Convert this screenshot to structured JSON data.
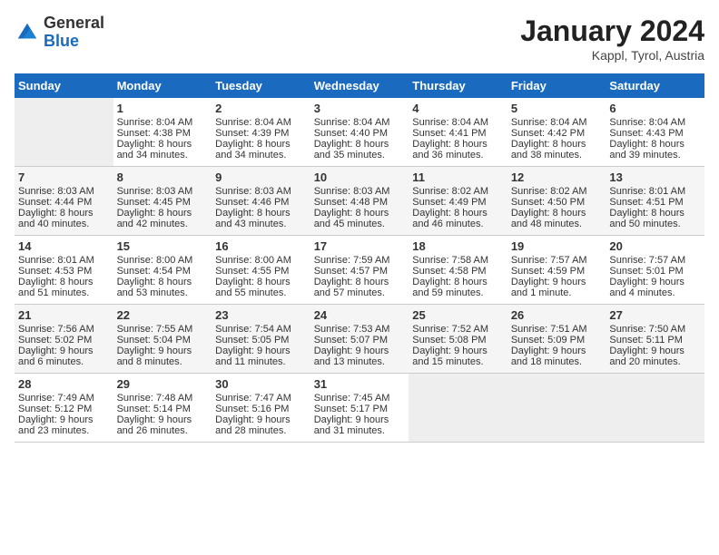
{
  "header": {
    "logo_general": "General",
    "logo_blue": "Blue",
    "month_title": "January 2024",
    "location": "Kappl, Tyrol, Austria"
  },
  "days_of_week": [
    "Sunday",
    "Monday",
    "Tuesday",
    "Wednesday",
    "Thursday",
    "Friday",
    "Saturday"
  ],
  "weeks": [
    {
      "cells": [
        {
          "day": "",
          "content": ""
        },
        {
          "day": "1",
          "content": "Sunrise: 8:04 AM\nSunset: 4:38 PM\nDaylight: 8 hours\nand 34 minutes."
        },
        {
          "day": "2",
          "content": "Sunrise: 8:04 AM\nSunset: 4:39 PM\nDaylight: 8 hours\nand 34 minutes."
        },
        {
          "day": "3",
          "content": "Sunrise: 8:04 AM\nSunset: 4:40 PM\nDaylight: 8 hours\nand 35 minutes."
        },
        {
          "day": "4",
          "content": "Sunrise: 8:04 AM\nSunset: 4:41 PM\nDaylight: 8 hours\nand 36 minutes."
        },
        {
          "day": "5",
          "content": "Sunrise: 8:04 AM\nSunset: 4:42 PM\nDaylight: 8 hours\nand 38 minutes."
        },
        {
          "day": "6",
          "content": "Sunrise: 8:04 AM\nSunset: 4:43 PM\nDaylight: 8 hours\nand 39 minutes."
        }
      ]
    },
    {
      "cells": [
        {
          "day": "7",
          "content": "Sunrise: 8:03 AM\nSunset: 4:44 PM\nDaylight: 8 hours\nand 40 minutes."
        },
        {
          "day": "8",
          "content": "Sunrise: 8:03 AM\nSunset: 4:45 PM\nDaylight: 8 hours\nand 42 minutes."
        },
        {
          "day": "9",
          "content": "Sunrise: 8:03 AM\nSunset: 4:46 PM\nDaylight: 8 hours\nand 43 minutes."
        },
        {
          "day": "10",
          "content": "Sunrise: 8:03 AM\nSunset: 4:48 PM\nDaylight: 8 hours\nand 45 minutes."
        },
        {
          "day": "11",
          "content": "Sunrise: 8:02 AM\nSunset: 4:49 PM\nDaylight: 8 hours\nand 46 minutes."
        },
        {
          "day": "12",
          "content": "Sunrise: 8:02 AM\nSunset: 4:50 PM\nDaylight: 8 hours\nand 48 minutes."
        },
        {
          "day": "13",
          "content": "Sunrise: 8:01 AM\nSunset: 4:51 PM\nDaylight: 8 hours\nand 50 minutes."
        }
      ]
    },
    {
      "cells": [
        {
          "day": "14",
          "content": "Sunrise: 8:01 AM\nSunset: 4:53 PM\nDaylight: 8 hours\nand 51 minutes."
        },
        {
          "day": "15",
          "content": "Sunrise: 8:00 AM\nSunset: 4:54 PM\nDaylight: 8 hours\nand 53 minutes."
        },
        {
          "day": "16",
          "content": "Sunrise: 8:00 AM\nSunset: 4:55 PM\nDaylight: 8 hours\nand 55 minutes."
        },
        {
          "day": "17",
          "content": "Sunrise: 7:59 AM\nSunset: 4:57 PM\nDaylight: 8 hours\nand 57 minutes."
        },
        {
          "day": "18",
          "content": "Sunrise: 7:58 AM\nSunset: 4:58 PM\nDaylight: 8 hours\nand 59 minutes."
        },
        {
          "day": "19",
          "content": "Sunrise: 7:57 AM\nSunset: 4:59 PM\nDaylight: 9 hours\nand 1 minute."
        },
        {
          "day": "20",
          "content": "Sunrise: 7:57 AM\nSunset: 5:01 PM\nDaylight: 9 hours\nand 4 minutes."
        }
      ]
    },
    {
      "cells": [
        {
          "day": "21",
          "content": "Sunrise: 7:56 AM\nSunset: 5:02 PM\nDaylight: 9 hours\nand 6 minutes."
        },
        {
          "day": "22",
          "content": "Sunrise: 7:55 AM\nSunset: 5:04 PM\nDaylight: 9 hours\nand 8 minutes."
        },
        {
          "day": "23",
          "content": "Sunrise: 7:54 AM\nSunset: 5:05 PM\nDaylight: 9 hours\nand 11 minutes."
        },
        {
          "day": "24",
          "content": "Sunrise: 7:53 AM\nSunset: 5:07 PM\nDaylight: 9 hours\nand 13 minutes."
        },
        {
          "day": "25",
          "content": "Sunrise: 7:52 AM\nSunset: 5:08 PM\nDaylight: 9 hours\nand 15 minutes."
        },
        {
          "day": "26",
          "content": "Sunrise: 7:51 AM\nSunset: 5:09 PM\nDaylight: 9 hours\nand 18 minutes."
        },
        {
          "day": "27",
          "content": "Sunrise: 7:50 AM\nSunset: 5:11 PM\nDaylight: 9 hours\nand 20 minutes."
        }
      ]
    },
    {
      "cells": [
        {
          "day": "28",
          "content": "Sunrise: 7:49 AM\nSunset: 5:12 PM\nDaylight: 9 hours\nand 23 minutes."
        },
        {
          "day": "29",
          "content": "Sunrise: 7:48 AM\nSunset: 5:14 PM\nDaylight: 9 hours\nand 26 minutes."
        },
        {
          "day": "30",
          "content": "Sunrise: 7:47 AM\nSunset: 5:16 PM\nDaylight: 9 hours\nand 28 minutes."
        },
        {
          "day": "31",
          "content": "Sunrise: 7:45 AM\nSunset: 5:17 PM\nDaylight: 9 hours\nand 31 minutes."
        },
        {
          "day": "",
          "content": ""
        },
        {
          "day": "",
          "content": ""
        },
        {
          "day": "",
          "content": ""
        }
      ]
    }
  ]
}
